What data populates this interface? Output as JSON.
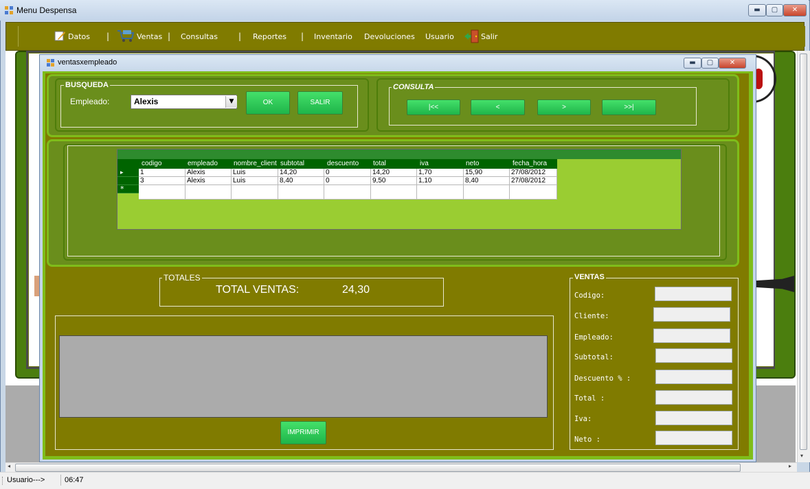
{
  "main_window": {
    "title": "Menu Despensa"
  },
  "menu": {
    "items": [
      "Datos",
      "Ventas",
      "Consultas",
      "Reportes",
      "Inventario",
      "Devoluciones",
      "Usuario",
      "Salir"
    ],
    "separator": "|"
  },
  "child_window": {
    "title": "ventasxempleado"
  },
  "busqueda": {
    "group_label": "BUSQUEDA",
    "empleado_label": "Empleado:",
    "empleado_value": "Alexis",
    "ok_label": "OK",
    "salir_label": "SALIR"
  },
  "consulta": {
    "group_label": "CONSULTA",
    "first_label": "|<<",
    "prev_label": "<",
    "next_label": ">",
    "last_label": ">>|"
  },
  "grid": {
    "columns": [
      "codigo",
      "empleado",
      "nombre_client",
      "subtotal",
      "descuento",
      "total",
      "iva",
      "neto",
      "fecha_hora"
    ],
    "rows": [
      [
        "1",
        "Alexis",
        "Luis",
        "14,20",
        "0",
        "14,20",
        "1,70",
        "15,90",
        "27/08/2012"
      ],
      [
        "3",
        "Alexis",
        "Luis",
        "8,40",
        "0",
        "9,50",
        "1,10",
        "8,40",
        "27/08/2012"
      ]
    ],
    "current_row_marker": "▸",
    "new_row_marker": "*"
  },
  "totales": {
    "group_label": "TOTALES",
    "label": "TOTAL VENTAS:",
    "value": "24,30"
  },
  "print": {
    "button_label": "IMPRIMIR"
  },
  "ventas": {
    "group_label": "VENTAS",
    "fields": [
      "Codigo:",
      "Cliente:",
      "Empleado:",
      "Subtotal:",
      "Descuento % :",
      "Total :",
      "Iva:",
      "Neto :"
    ]
  },
  "status": {
    "user_label": "Usuario--->",
    "time": "06:47"
  },
  "colors": {
    "olive": "#807b00",
    "lime": "#7fbd1a",
    "green_button": "#2ec458",
    "grid_header": "#006400"
  }
}
